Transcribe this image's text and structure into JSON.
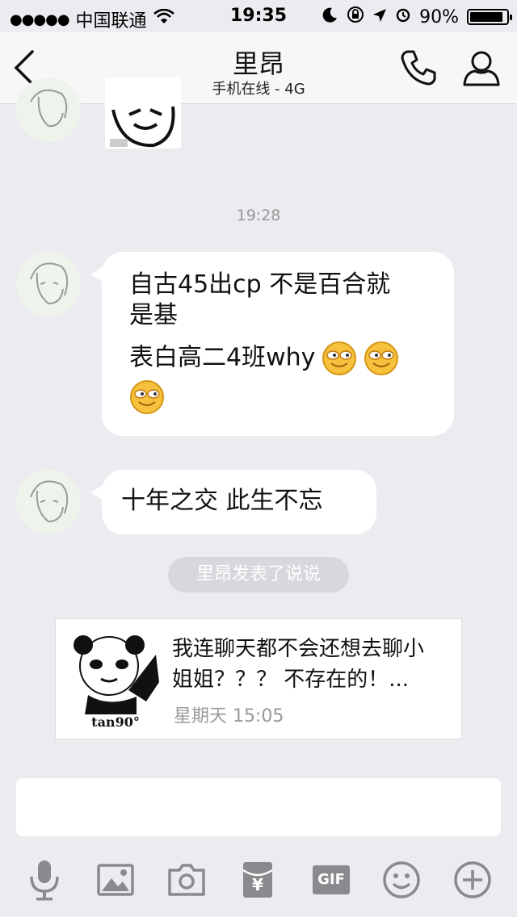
{
  "status": {
    "carrier": "中国联通",
    "time": "19:35",
    "battery": "90%",
    "battery_level": 0.9
  },
  "header": {
    "title": "里昂",
    "subtitle": "手机在线 - 4G"
  },
  "messages": [
    {
      "timestamp": "19:28"
    },
    {
      "line1": "自古45出cp  不是百合就",
      "line2": "是基",
      "line3": "表白高二4班why"
    },
    {
      "text": "十年之交  此生不忘"
    }
  ],
  "notice": "里昂发表了说说",
  "shared_post": {
    "image_caption": "tan90°",
    "line1": "我连聊天都不会还想去聊小",
    "line2": "姐姐？？？  不存在的！...",
    "date": "星期天 15:05"
  },
  "toolbar_icons": [
    "microphone-icon",
    "image-icon",
    "camera-icon",
    "red-packet-icon",
    "gif-icon",
    "emoji-icon",
    "plus-icon"
  ],
  "toolbar_gif_label": "GIF",
  "red_packet_symbol": "¥",
  "colors": {
    "background": "#ebebf0",
    "bubble": "#ffffff",
    "icon_gray": "#8a8a8e",
    "emoji_yellow": "#f6b52c"
  }
}
